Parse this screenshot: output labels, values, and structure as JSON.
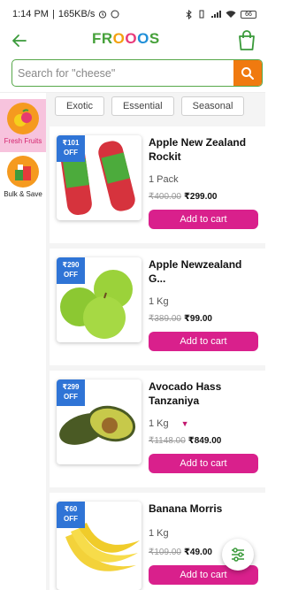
{
  "status_bar": {
    "time": "1:14 PM",
    "speed": "165KB/s",
    "battery": "66"
  },
  "header": {
    "logo_text": [
      "FR",
      "O",
      "O",
      "O",
      "S"
    ],
    "brand_color": "#46a13a"
  },
  "search": {
    "placeholder": "Search for \"cheese\""
  },
  "sidebar": {
    "items": [
      {
        "label": "Fresh Fruits",
        "active": true
      },
      {
        "label": "Bulk & Save",
        "active": false
      }
    ]
  },
  "chips": [
    "Exotic",
    "Essential",
    "Seasonal"
  ],
  "products": [
    {
      "badge_line1": "₹101",
      "badge_line2": "OFF",
      "title": "Apple New Zealand Rockit",
      "qty": "1 Pack",
      "mrp": "₹400.00",
      "price": "₹299.00",
      "button": "Add to cart"
    },
    {
      "badge_line1": "₹290",
      "badge_line2": "OFF",
      "title": "Apple Newzealand G...",
      "qty": "1 Kg",
      "mrp": "₹389.00",
      "price": "₹99.00",
      "button": "Add to cart"
    },
    {
      "badge_line1": "₹299",
      "badge_line2": "OFF",
      "title": "Avocado Hass Tanzaniya",
      "qty": "1 Kg",
      "mrp": "₹1148.00",
      "price": "₹849.00",
      "button": "Add to cart"
    },
    {
      "badge_line1": "₹60",
      "badge_line2": "OFF",
      "title": "Banana Morris",
      "qty": "1 Kg",
      "mrp": "₹109.00",
      "price": "₹49.00",
      "button": "Add to cart"
    }
  ],
  "colors": {
    "accent": "#d9208c",
    "badge": "#2f74d6",
    "search_button": "#f07a10"
  }
}
